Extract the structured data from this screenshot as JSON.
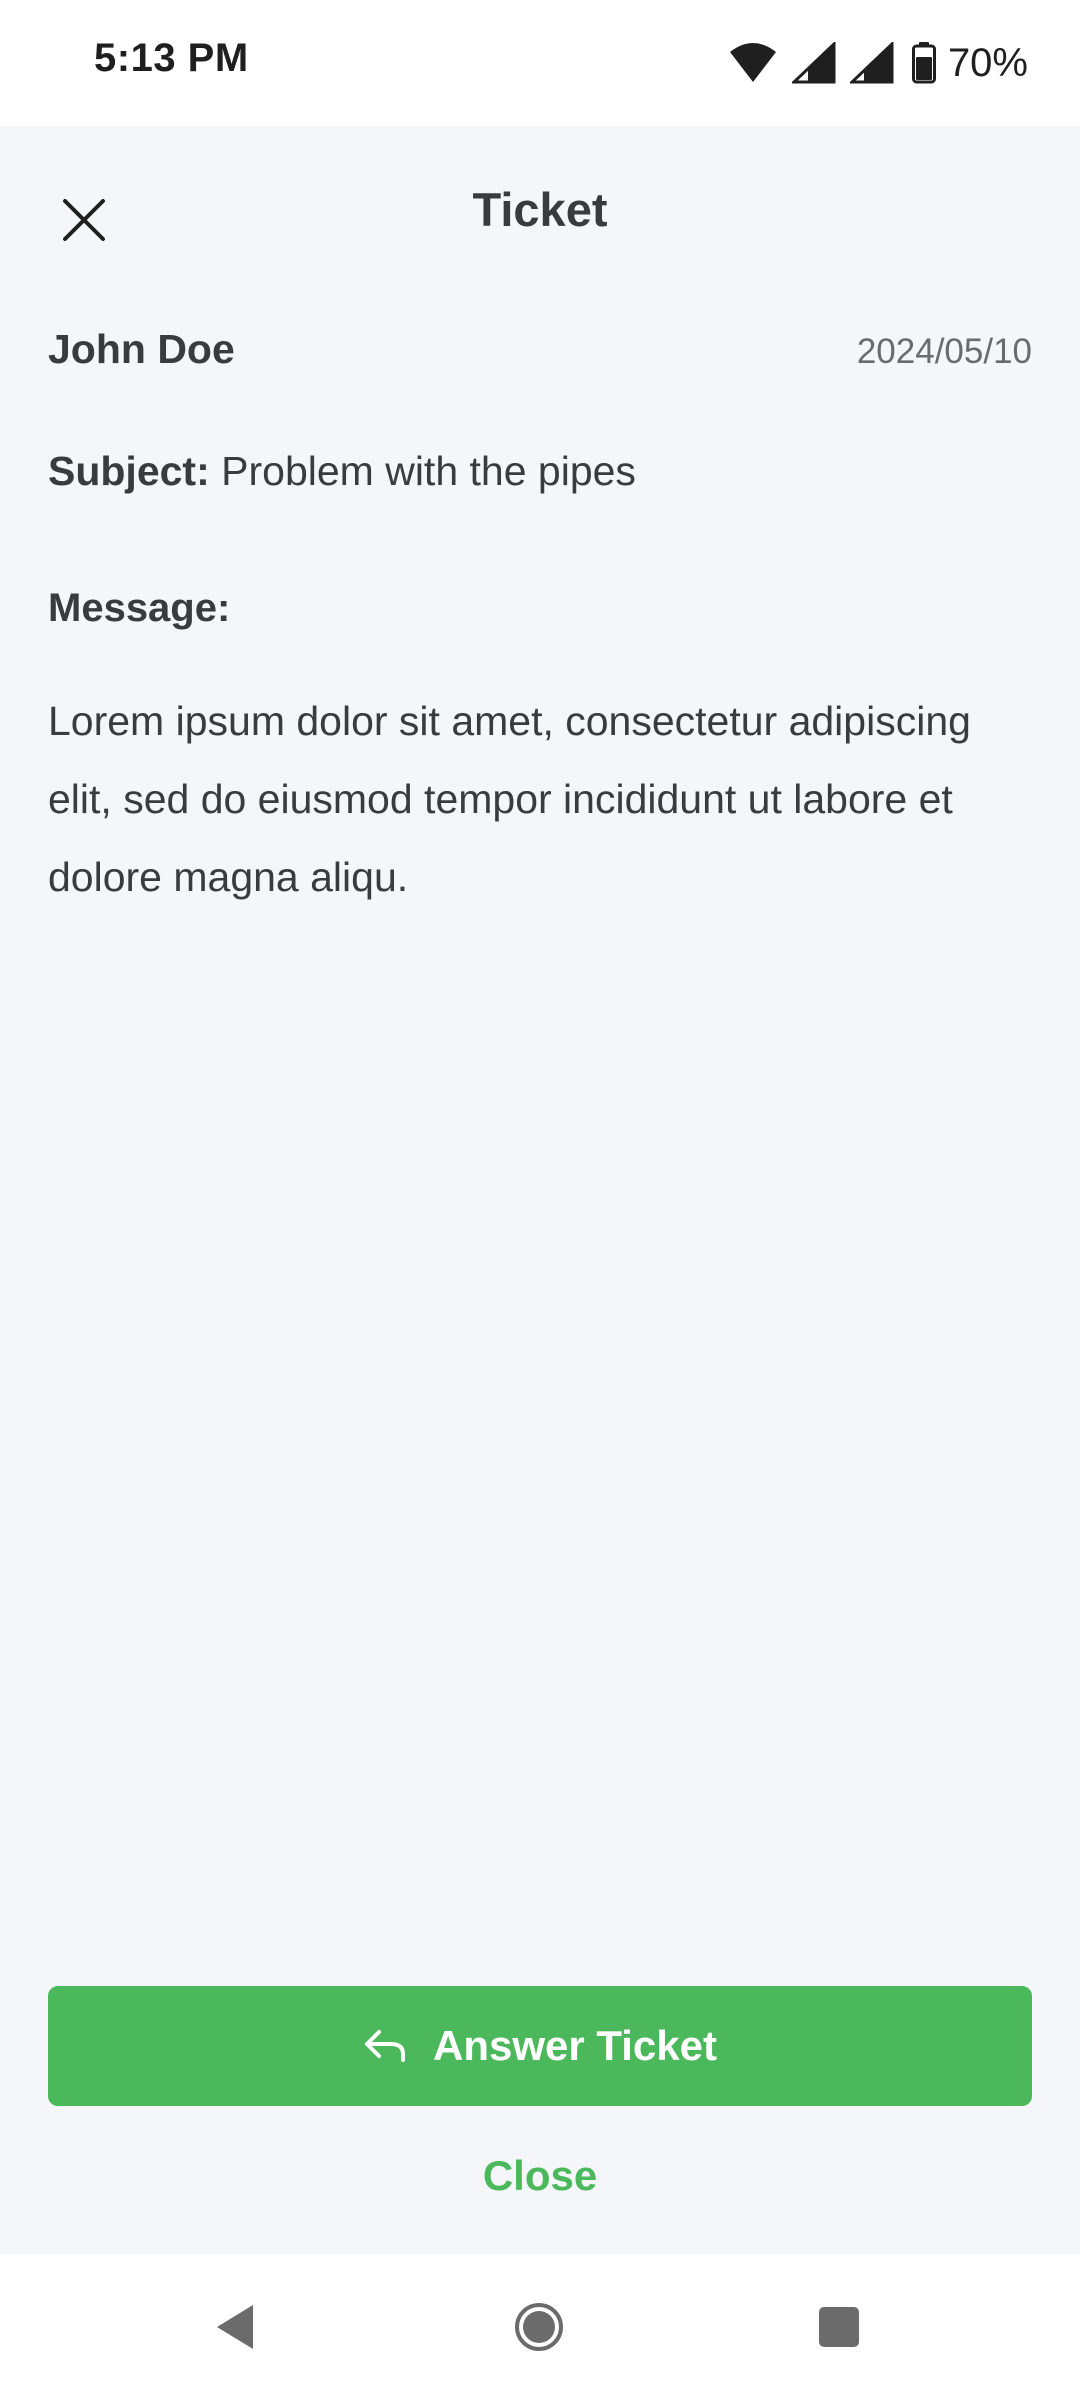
{
  "status_bar": {
    "time": "5:13 PM",
    "battery_percent": "70%",
    "icons": [
      "wifi-icon",
      "cell-signal-icon",
      "cell-signal-icon",
      "battery-icon"
    ]
  },
  "header": {
    "title": "Ticket",
    "close_icon": "close-icon"
  },
  "ticket": {
    "sender": "John Doe",
    "date": "2024/05/10",
    "subject_label": "Subject:",
    "subject": "Problem with the pipes",
    "message_label": "Message:",
    "message": "Lorem ipsum dolor sit amet, consectetur adipiscing elit, sed do eiusmod tempor incididunt ut labore et dolore magna aliqu."
  },
  "actions": {
    "answer_label": "Answer Ticket",
    "answer_icon": "reply-icon",
    "close_label": "Close"
  },
  "nav": {
    "back_icon": "back-icon",
    "home_icon": "home-icon",
    "recents_icon": "recents-icon"
  },
  "colors": {
    "accent": "#4cb85c",
    "background": "#f4f6fa",
    "text": "#3a3b3f"
  }
}
